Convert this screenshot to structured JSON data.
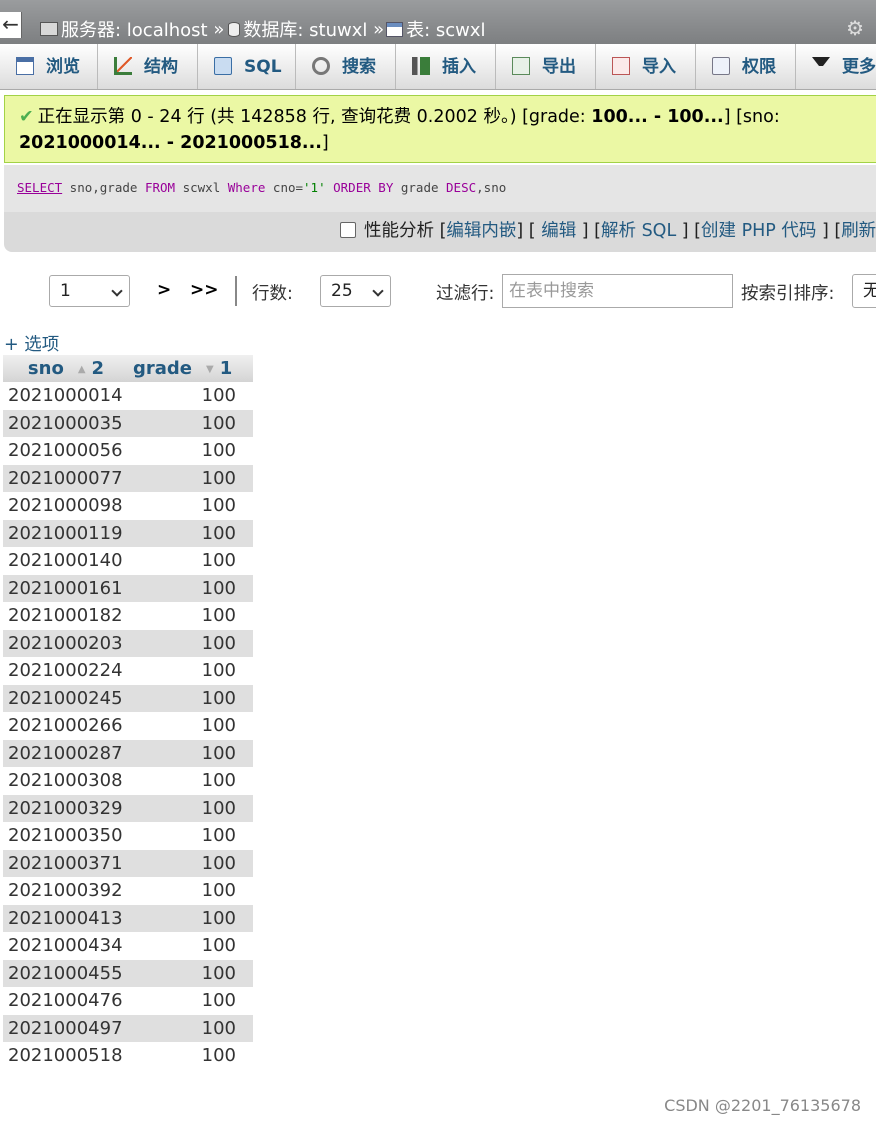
{
  "breadcrumb": {
    "back": "←",
    "server": "服务器: localhost",
    "sep1": "»",
    "database": "数据库: stuwxl",
    "sep2": "»",
    "table": "表: scwxl",
    "settings_icon": "gear-icon"
  },
  "tabs": [
    {
      "label": "浏览",
      "icon": "browse-icon"
    },
    {
      "label": "结构",
      "icon": "structure-icon"
    },
    {
      "label": "SQL",
      "icon": "sql-icon"
    },
    {
      "label": "搜索",
      "icon": "search-icon"
    },
    {
      "label": "插入",
      "icon": "insert-icon"
    },
    {
      "label": "导出",
      "icon": "export-icon"
    },
    {
      "label": "导入",
      "icon": "import-icon"
    },
    {
      "label": "权限",
      "icon": "privileges-icon"
    },
    {
      "label": "更多",
      "icon": "more-icon"
    }
  ],
  "notice": {
    "icon": "check-icon",
    "text_part1": "正在显示第 0 - 24 行 (共 142858 行, 查询花费 0.2002 秒。) [grade: ",
    "grade_range": "100... - 100...",
    "text_part2": "] [sno:",
    "sno_range": "2021000014... - 2021000518...",
    "text_part3": "]"
  },
  "sql": {
    "k_select": "SELECT",
    "cols": " sno,grade ",
    "k_from": "FROM",
    "tbl": " scwxl ",
    "k_where": "Where",
    "cond": " cno=",
    "val": "'1'",
    "k_orderby": " ORDER BY",
    "ord1": " grade ",
    "k_desc": "DESC",
    "ord2": ",sno"
  },
  "tools": {
    "profiling": "性能分析",
    "b1": "[",
    "edit_inline": "编辑内嵌",
    "b2": "] [",
    "edit": "编辑",
    "b3": "] [",
    "explain": "解析 SQL",
    "b4": "] [",
    "create_php": "创建 PHP 代码",
    "b5": "] [",
    "refresh": "刷新"
  },
  "navigation": {
    "page": "1",
    "next": ">",
    "last": ">>",
    "rows_label": "行数:",
    "rows_value": "25",
    "filter_label": "过滤行:",
    "filter_placeholder": "在表中搜索",
    "sort_label": "按索引排序:",
    "sort_value": "无"
  },
  "options_link": "+ 选项",
  "table": {
    "columns": [
      {
        "name": "sno",
        "sort_arrow": "▲",
        "sort_order": "2"
      },
      {
        "name": "grade",
        "sort_arrow": "▼",
        "sort_order": "1"
      }
    ],
    "rows": [
      {
        "sno": "2021000014",
        "grade": "100"
      },
      {
        "sno": "2021000035",
        "grade": "100"
      },
      {
        "sno": "2021000056",
        "grade": "100"
      },
      {
        "sno": "2021000077",
        "grade": "100"
      },
      {
        "sno": "2021000098",
        "grade": "100"
      },
      {
        "sno": "2021000119",
        "grade": "100"
      },
      {
        "sno": "2021000140",
        "grade": "100"
      },
      {
        "sno": "2021000161",
        "grade": "100"
      },
      {
        "sno": "2021000182",
        "grade": "100"
      },
      {
        "sno": "2021000203",
        "grade": "100"
      },
      {
        "sno": "2021000224",
        "grade": "100"
      },
      {
        "sno": "2021000245",
        "grade": "100"
      },
      {
        "sno": "2021000266",
        "grade": "100"
      },
      {
        "sno": "2021000287",
        "grade": "100"
      },
      {
        "sno": "2021000308",
        "grade": "100"
      },
      {
        "sno": "2021000329",
        "grade": "100"
      },
      {
        "sno": "2021000350",
        "grade": "100"
      },
      {
        "sno": "2021000371",
        "grade": "100"
      },
      {
        "sno": "2021000392",
        "grade": "100"
      },
      {
        "sno": "2021000413",
        "grade": "100"
      },
      {
        "sno": "2021000434",
        "grade": "100"
      },
      {
        "sno": "2021000455",
        "grade": "100"
      },
      {
        "sno": "2021000476",
        "grade": "100"
      },
      {
        "sno": "2021000497",
        "grade": "100"
      },
      {
        "sno": "2021000518",
        "grade": "100"
      }
    ]
  },
  "watermark": "CSDN @2201_76135678"
}
